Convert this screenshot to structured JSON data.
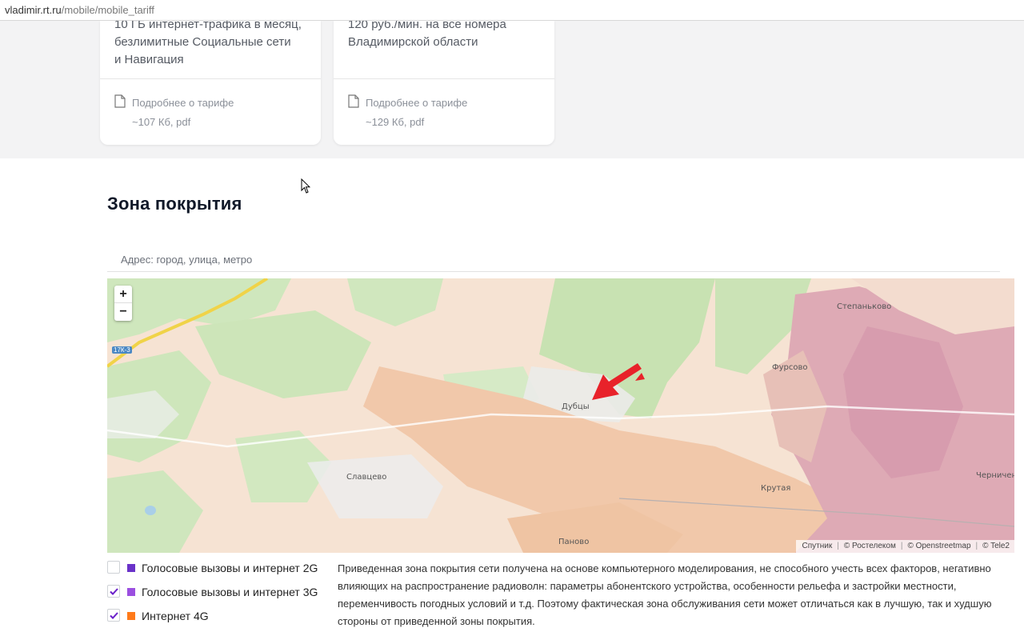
{
  "browser": {
    "domain": "vladimir.rt.ru",
    "path": "/mobile/mobile_tariff"
  },
  "cards": [
    {
      "desc_lines": [
        "10 ГБ интернет-трафика в месяц,",
        "безлимитные Социальные сети",
        "и Навигация"
      ],
      "doc_title": "Подробнее о тарифе",
      "doc_size": "~107 Кб, pdf"
    },
    {
      "desc_lines": [
        "120 руб./мин. на все номера",
        "Владимирской области"
      ],
      "doc_title": "Подробнее о тарифе",
      "doc_size": "~129 Кб, pdf"
    }
  ],
  "coverage": {
    "title": "Зона покрытия",
    "search_placeholder": "Адрес: город, улица, метро"
  },
  "map": {
    "zoom_in": "+",
    "zoom_out": "−",
    "road_label": "17К-3",
    "places": [
      "Степанько­во",
      "Фурсово",
      "Дубцы",
      "Славцево",
      "Крутая",
      "Черничено",
      "Паново"
    ],
    "attribution": [
      "Спутник",
      "© Ростелеком",
      "© Openstreetmap",
      "© Tele2"
    ],
    "colors": {
      "forest": "#c9e4b4",
      "coverage": "#f4cdb3",
      "coverage_strong": "#d9a2b2",
      "road": "#f0d348"
    }
  },
  "legend": [
    {
      "label": "Голосовые вызовы и интернет 2G",
      "checked": false,
      "color": "#6a32c9"
    },
    {
      "label": "Голосовые вызовы и интернет 3G",
      "checked": true,
      "color": "#9b4fe0"
    },
    {
      "label": "Интернет 4G",
      "checked": true,
      "color": "#ff7a1a"
    }
  ],
  "note": "Приведенная зона покрытия сети получена на основе компьютерного моделирования, не способного учесть всех факторов, негативно влияющих на распространение радиоволн: параметры абонентского устройства, особенности рельефа и застройки местности, переменчивость погодных условий и т.д. Поэтому фактическая зона обслуживания сети может отличаться как в лучшую, так и худшую стороны от приведенной зоны покрытия."
}
